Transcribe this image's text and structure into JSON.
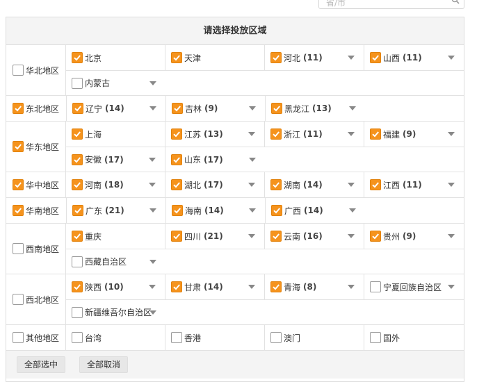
{
  "search": {
    "placeholder": "省/市"
  },
  "panel": {
    "title": "请选择投放区域"
  },
  "regions": [
    {
      "name": "华北地区",
      "checked": false,
      "lines": [
        [
          {
            "name": "北京",
            "count": "",
            "checked": true,
            "dropdown": false
          },
          {
            "name": "天津",
            "count": "",
            "checked": true,
            "dropdown": false
          },
          {
            "name": "河北",
            "count": "(11)",
            "checked": true,
            "dropdown": true
          },
          {
            "name": "山西",
            "count": "(11)",
            "checked": true,
            "dropdown": true
          }
        ],
        [
          {
            "name": "内蒙古",
            "count": "",
            "checked": false,
            "dropdown": true
          }
        ]
      ]
    },
    {
      "name": "东北地区",
      "checked": true,
      "lines": [
        [
          {
            "name": "辽宁",
            "count": "(14)",
            "checked": true,
            "dropdown": true
          },
          {
            "name": "吉林",
            "count": "(9)",
            "checked": true,
            "dropdown": true
          },
          {
            "name": "黑龙江",
            "count": "(13)",
            "checked": true,
            "dropdown": true
          }
        ]
      ]
    },
    {
      "name": "华东地区",
      "checked": true,
      "lines": [
        [
          {
            "name": "上海",
            "count": "",
            "checked": true,
            "dropdown": false
          },
          {
            "name": "江苏",
            "count": "(13)",
            "checked": true,
            "dropdown": true
          },
          {
            "name": "浙江",
            "count": "(11)",
            "checked": true,
            "dropdown": true
          },
          {
            "name": "福建",
            "count": "(9)",
            "checked": true,
            "dropdown": true
          }
        ],
        [
          {
            "name": "安徽",
            "count": "(17)",
            "checked": true,
            "dropdown": true
          },
          {
            "name": "山东",
            "count": "(17)",
            "checked": true,
            "dropdown": true
          }
        ]
      ]
    },
    {
      "name": "华中地区",
      "checked": true,
      "lines": [
        [
          {
            "name": "河南",
            "count": "(18)",
            "checked": true,
            "dropdown": true
          },
          {
            "name": "湖北",
            "count": "(17)",
            "checked": true,
            "dropdown": true
          },
          {
            "name": "湖南",
            "count": "(14)",
            "checked": true,
            "dropdown": true
          },
          {
            "name": "江西",
            "count": "(11)",
            "checked": true,
            "dropdown": true
          }
        ]
      ]
    },
    {
      "name": "华南地区",
      "checked": true,
      "lines": [
        [
          {
            "name": "广东",
            "count": "(21)",
            "checked": true,
            "dropdown": true
          },
          {
            "name": "海南",
            "count": "(14)",
            "checked": true,
            "dropdown": true
          },
          {
            "name": "广西",
            "count": "(14)",
            "checked": true,
            "dropdown": true
          }
        ]
      ]
    },
    {
      "name": "西南地区",
      "checked": false,
      "lines": [
        [
          {
            "name": "重庆",
            "count": "",
            "checked": true,
            "dropdown": false
          },
          {
            "name": "四川",
            "count": "(21)",
            "checked": true,
            "dropdown": true
          },
          {
            "name": "云南",
            "count": "(16)",
            "checked": true,
            "dropdown": true
          },
          {
            "name": "贵州",
            "count": "(9)",
            "checked": true,
            "dropdown": true
          }
        ],
        [
          {
            "name": "西藏自治区",
            "count": "",
            "checked": false,
            "dropdown": true
          }
        ]
      ]
    },
    {
      "name": "西北地区",
      "checked": false,
      "lines": [
        [
          {
            "name": "陕西",
            "count": "(10)",
            "checked": true,
            "dropdown": true
          },
          {
            "name": "甘肃",
            "count": "(14)",
            "checked": true,
            "dropdown": true
          },
          {
            "name": "青海",
            "count": "(8)",
            "checked": true,
            "dropdown": true
          },
          {
            "name": "宁夏回族自治区",
            "count": "",
            "checked": false,
            "dropdown": true
          }
        ],
        [
          {
            "name": "新疆维吾尔自治区",
            "count": "",
            "checked": false,
            "dropdown": true
          }
        ]
      ]
    },
    {
      "name": "其他地区",
      "checked": false,
      "lines": [
        [
          {
            "name": "台湾",
            "count": "",
            "checked": false,
            "dropdown": false
          },
          {
            "name": "香港",
            "count": "",
            "checked": false,
            "dropdown": false
          },
          {
            "name": "澳门",
            "count": "",
            "checked": false,
            "dropdown": false
          },
          {
            "name": "国外",
            "count": "",
            "checked": false,
            "dropdown": false
          }
        ]
      ]
    }
  ],
  "footer": {
    "select_all": "全部选中",
    "cancel_all": "全部取消"
  },
  "colors": {
    "accent": "#f5931d",
    "header_bg": "#f4f4f4",
    "border": "#e2e2e2"
  },
  "icons": {
    "search": "search-icon",
    "checkbox": "checkmark-icon",
    "dropdown": "triangle-down-icon"
  }
}
